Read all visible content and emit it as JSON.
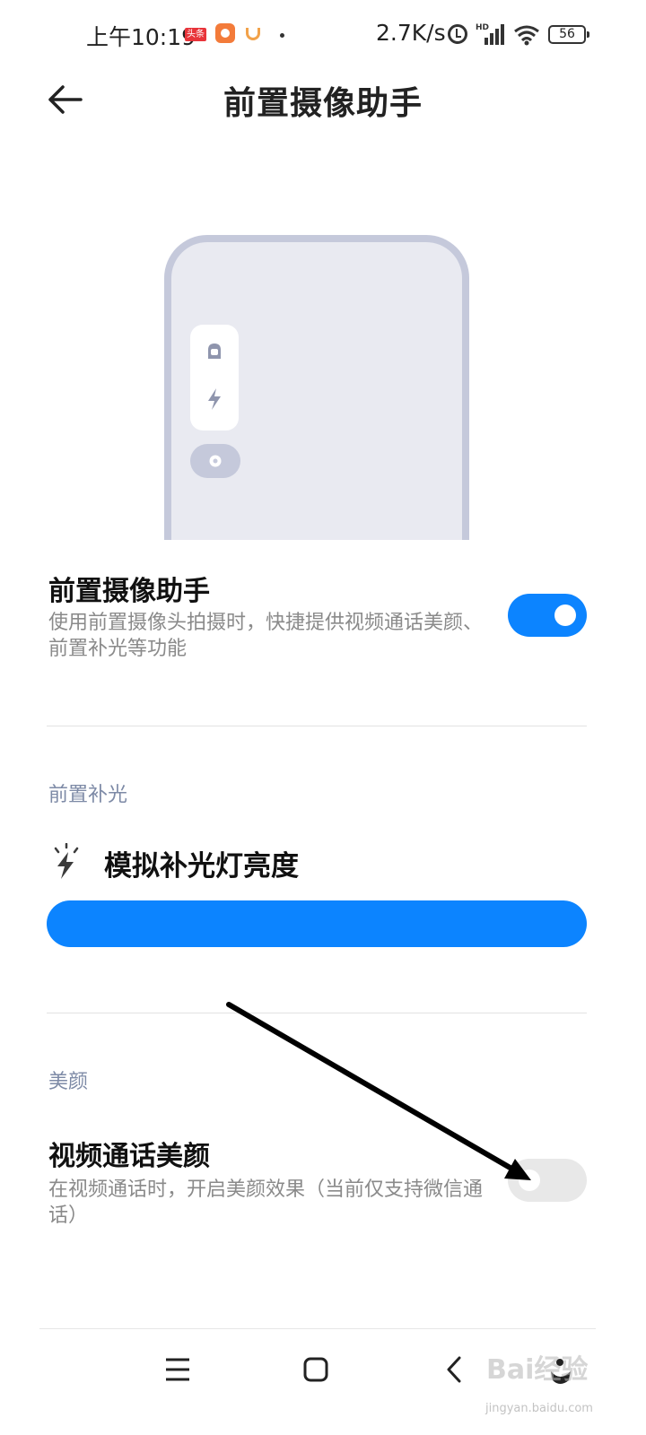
{
  "status_bar": {
    "time": "上午10:19",
    "badge": "头条",
    "net_speed": "2.7K/s",
    "signal_label": "HD",
    "battery": "56"
  },
  "header": {
    "title": "前置摄像助手"
  },
  "main_toggle": {
    "title": "前置摄像助手",
    "description": "使用前置摄像头拍摄时，快捷提供视频通话美颜、前置补光等功能",
    "enabled": true
  },
  "fill_light": {
    "section_label": "前置补光",
    "title": "模拟补光灯亮度",
    "brightness_fraction": 1.0
  },
  "beauty": {
    "section_label": "美颜",
    "title": "视频通话美颜",
    "description": "在视频通话时，开启美颜效果（当前仅支持微信通话）",
    "enabled": false
  },
  "watermark": {
    "main": "Bai经验",
    "sub": "jingyan.baidu.com"
  },
  "colors": {
    "accent": "#0c84ff",
    "illustration_frame": "#c5c9db",
    "illustration_bg": "#e9eaf1",
    "section_label": "#7d8aa6"
  }
}
